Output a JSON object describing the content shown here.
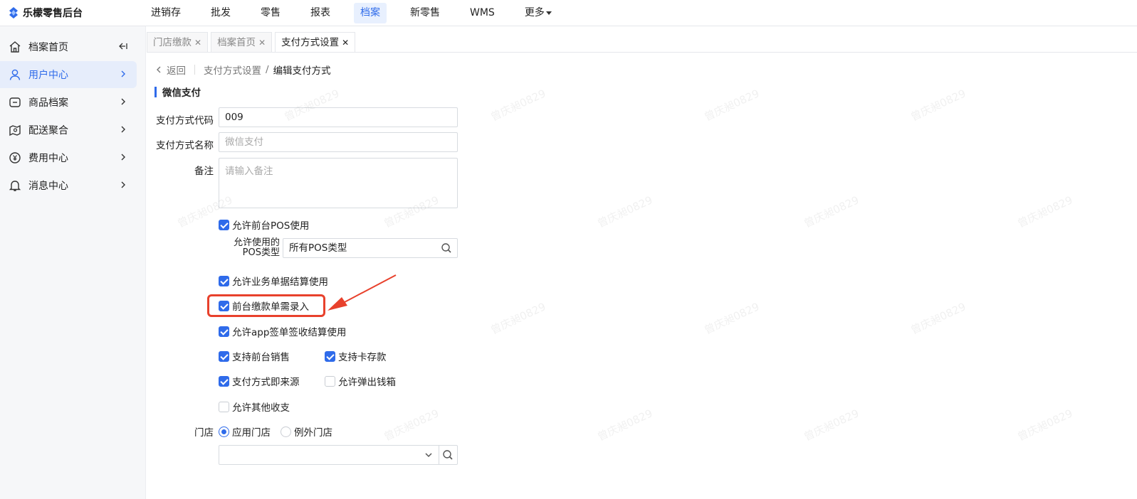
{
  "app": {
    "title": "乐檬零售后台"
  },
  "topnav": {
    "items": [
      {
        "label": "进销存"
      },
      {
        "label": "批发"
      },
      {
        "label": "零售"
      },
      {
        "label": "报表"
      },
      {
        "label": "档案"
      },
      {
        "label": "新零售"
      },
      {
        "label": "WMS"
      },
      {
        "label": "更多"
      }
    ],
    "active": "档案"
  },
  "sidebar": {
    "items": [
      {
        "label": "档案首页",
        "icon": "home-icon"
      },
      {
        "label": "用户中心",
        "icon": "user-icon"
      },
      {
        "label": "商品档案",
        "icon": "product-icon"
      },
      {
        "label": "配送聚合",
        "icon": "delivery-icon"
      },
      {
        "label": "费用中心",
        "icon": "yen-icon"
      },
      {
        "label": "消息中心",
        "icon": "bell-icon"
      }
    ],
    "active": "用户中心"
  },
  "tabs": [
    {
      "label": "门店缴款"
    },
    {
      "label": "档案首页"
    },
    {
      "label": "支付方式设置"
    }
  ],
  "breadcrumb": {
    "back": "返回",
    "parent": "支付方式设置",
    "slash": "/",
    "current": "编辑支付方式"
  },
  "section": {
    "title": "微信支付"
  },
  "form": {
    "code_label": "支付方式代码",
    "code_value": "009",
    "name_label": "支付方式名称",
    "name_placeholder": "微信支付",
    "remark_label": "备注",
    "remark_placeholder": "请输入备注",
    "pos_allowed_label": "允许前台POS使用",
    "pos_type_label_1": "允许使用的",
    "pos_type_label_2": "POS类型",
    "pos_type_value": "所有POS类型",
    "biz_doc_label": "允许业务单据结算使用",
    "front_pay_label": "前台缴款单需录入",
    "app_sign_label": "允许app签单签收结算使用",
    "front_sale_label": "支持前台销售",
    "card_deposit_label": "支持卡存款",
    "instant_source_label": "支付方式即来源",
    "cash_drawer_label": "允许弹出钱箱",
    "other_income_label": "允许其他收支",
    "store_label": "门店",
    "store_apply_label": "应用门店",
    "store_except_label": "例外门店",
    "checks": {
      "pos_allowed": true,
      "biz_doc": true,
      "front_pay": true,
      "app_sign": true,
      "front_sale": true,
      "card_deposit": true,
      "instant_source": true,
      "cash_drawer": false,
      "other_income": false
    },
    "store_mode": "应用门店"
  },
  "colors": {
    "accent": "#2f6bea",
    "annotation": "#e8412c"
  },
  "watermark": "曾庆昶0829"
}
